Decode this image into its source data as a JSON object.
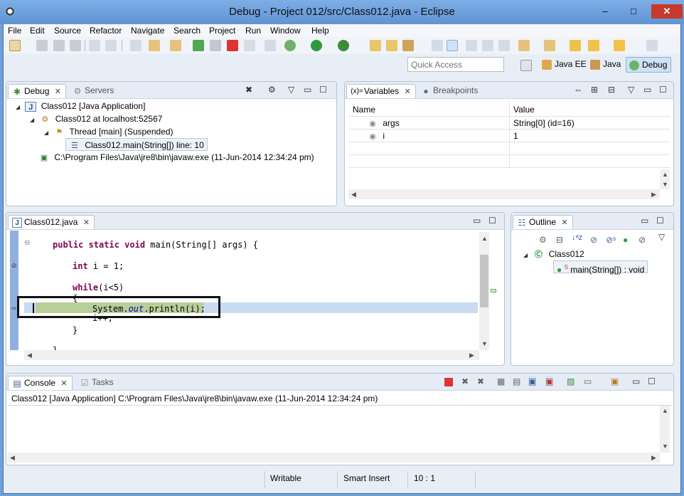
{
  "window": {
    "title": "Debug - Project 012/src/Class012.java - Eclipse",
    "minimize": "–",
    "maximize": "□",
    "close": "✕"
  },
  "menu": [
    "File",
    "Edit",
    "Source",
    "Refactor",
    "Navigate",
    "Search",
    "Project",
    "Run",
    "Window",
    "Help"
  ],
  "quick_access": {
    "placeholder": "Quick Access"
  },
  "perspectives": [
    "Java EE",
    "Java",
    "Debug"
  ],
  "debug_view": {
    "tabs": [
      {
        "label": "Debug",
        "active": true
      },
      {
        "label": "Servers",
        "active": false
      }
    ],
    "tree": [
      {
        "label": "Class012 [Java Application]"
      },
      {
        "label": "Class012 at localhost:52567"
      },
      {
        "label": "Thread [main] (Suspended)"
      },
      {
        "label": "Class012.main(String[]) line: 10"
      },
      {
        "label": "C:\\Program Files\\Java\\jre8\\bin\\javaw.exe (11-Jun-2014 12:34:24 pm)"
      }
    ]
  },
  "variables_view": {
    "tabs": [
      {
        "label": "Variables",
        "active": true
      },
      {
        "label": "Breakpoints",
        "active": false
      }
    ],
    "columns": [
      "Name",
      "Value"
    ],
    "rows": [
      {
        "name": "args",
        "value": "String[0]  (id=16)"
      },
      {
        "name": "i",
        "value": "1"
      }
    ]
  },
  "editor": {
    "tab": "Class012.java",
    "lines": {
      "l1_kw": "public static void",
      "l1_rest": " main(String[] args) {",
      "l2_kw": "int",
      "l2_rest": " i = 1;",
      "l3_kw": "while",
      "l3_rest": "(i<5)",
      "l4": "{",
      "l5_a": "System.",
      "l5_field": "out",
      "l5_b": ".println(i);",
      "l6": "i++;",
      "l7": "}",
      "l8": "}"
    }
  },
  "outline_view": {
    "tab": "Outline",
    "class_name": "Class012",
    "method": "main(String[]) : void",
    "static_marker": "S"
  },
  "console_view": {
    "tabs": [
      {
        "label": "Console",
        "active": true
      },
      {
        "label": "Tasks",
        "active": false
      }
    ],
    "header": "Class012 [Java Application] C:\\Program Files\\Java\\jre8\\bin\\javaw.exe (11-Jun-2014 12:34:24 pm)"
  },
  "status_bar": {
    "mode": "Writable",
    "insert": "Smart Insert",
    "position": "10 : 1"
  },
  "icons": {
    "minimize": "▭",
    "maximize": "☐",
    "close": "✕",
    "expand": "◢",
    "menu": "▽"
  },
  "colors": {
    "keyword": "#7f0055",
    "field": "#0000c0",
    "current_line": "#c9dbf1",
    "exec_line": "#b8cf9a",
    "title_bar": "#6fa0d8"
  }
}
